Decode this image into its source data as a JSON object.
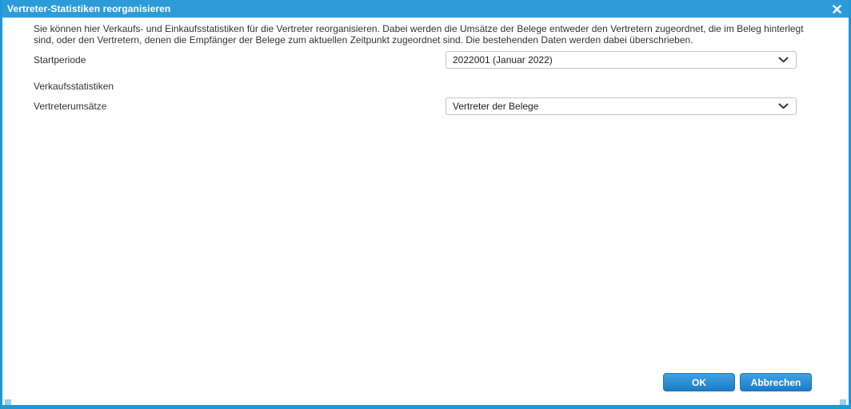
{
  "window": {
    "title": "Vertreter-Statistiken reorganisieren",
    "close_icon_glyph": "✕"
  },
  "intro": {
    "text": "Sie können hier Verkaufs- und Einkaufsstatistiken für die Vertreter reorganisieren. Dabei werden die Umsätze der Belege entweder den Vertretern zugeordnet, die im Beleg hinterlegt sind, oder den Vertretern, denen die Empfänger der Belege zum aktuellen Zeitpunkt zugeordnet sind. Die bestehenden Daten werden dabei überschrieben."
  },
  "form": {
    "start_period": {
      "label": "Startperiode",
      "value": "2022001 (Januar 2022)"
    },
    "sales_section_label": "Verkaufsstatistiken",
    "rep_revenue": {
      "label": "Vertreterumsätze",
      "value": "Vertreter der Belege"
    }
  },
  "footer": {
    "ok_label": "OK",
    "cancel_label": "Abbrechen"
  },
  "colors": {
    "titlebar_blue": "#2e9bd9",
    "border_blue": "#2196d5",
    "button_gradient_top": "#3ea2e2",
    "button_gradient_bottom": "#1e7cc6",
    "resize_grip": "#8fd2f1"
  }
}
